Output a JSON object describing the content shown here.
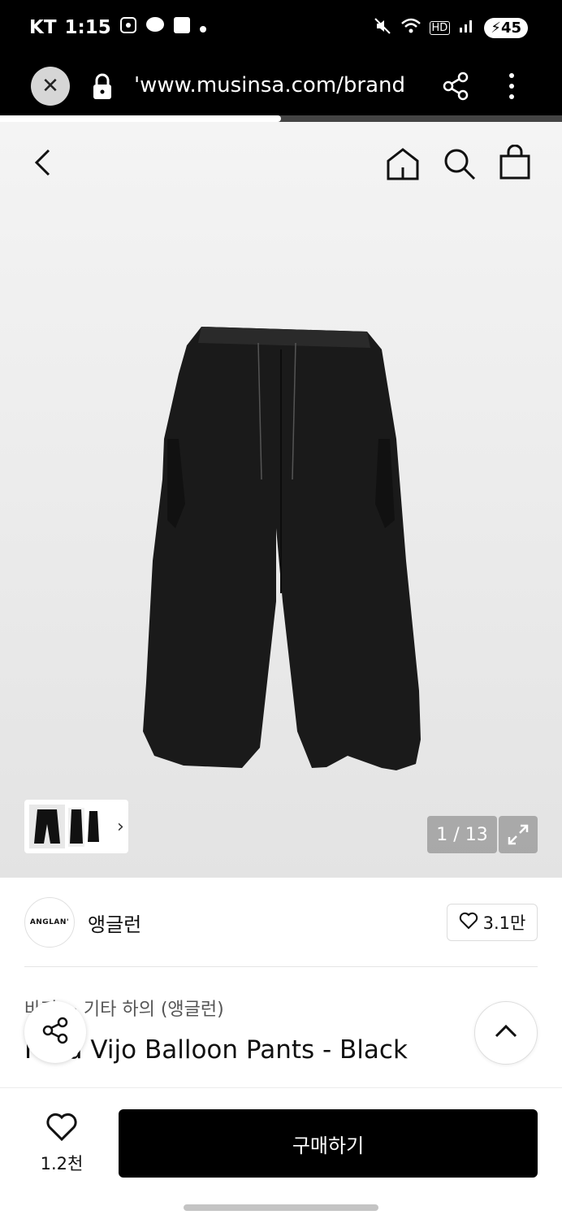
{
  "status_bar": {
    "carrier": "KT",
    "time": "1:15",
    "battery": "45",
    "network": "HD"
  },
  "browser": {
    "url": "'www.musinsa.com/brand",
    "page_load_progress": 0.5
  },
  "gallery": {
    "counter": "1 / 13"
  },
  "brand": {
    "logo_text": "ANGLAN'",
    "name": "앵글런",
    "likes": "3.1만"
  },
  "product": {
    "category": "바지 > 기타 하의 (앵글런)",
    "title": "Field Vijo Balloon Pants - Black"
  },
  "bottom_bar": {
    "wish_count": "1.2천",
    "buy_label": "구매하기"
  },
  "colors": {
    "accent": "#000000",
    "background": "#ffffff",
    "hero_background": "#eeeeee"
  },
  "icons": [
    "close-icon",
    "lock-icon",
    "share-icon",
    "more-icon",
    "back-icon",
    "home-icon",
    "search-icon",
    "bag-icon",
    "expand-icon",
    "heart-icon",
    "chevron-up-icon",
    "chevron-right-icon"
  ]
}
